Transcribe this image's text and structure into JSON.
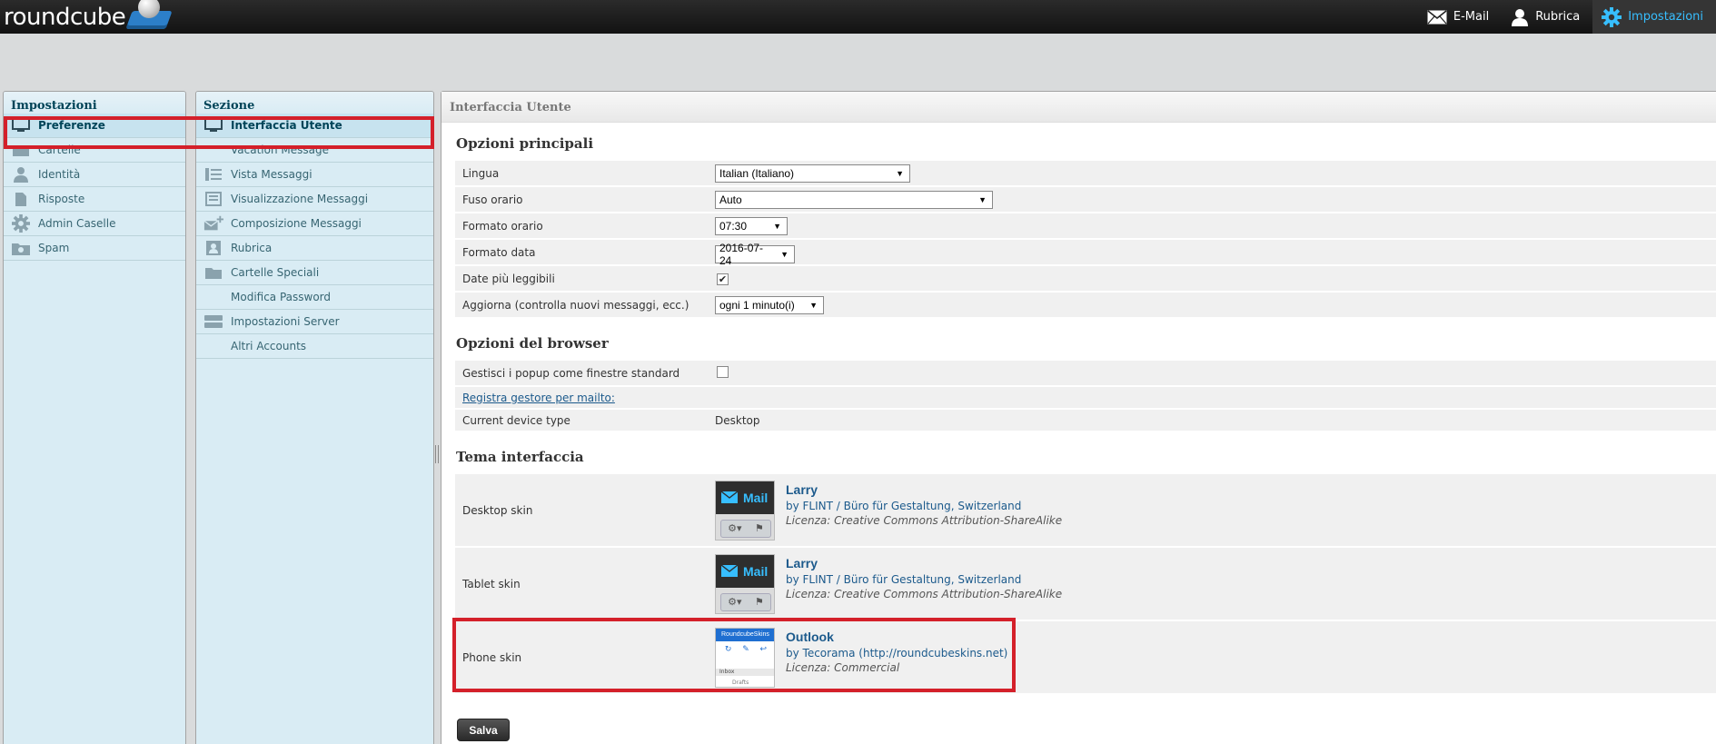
{
  "app": {
    "logo_text": "roundcube"
  },
  "topnav": [
    {
      "label": "E-Mail",
      "icon": "envelope-icon",
      "active": false
    },
    {
      "label": "Rubrica",
      "icon": "person-icon",
      "active": false
    },
    {
      "label": "Impostazioni",
      "icon": "gear-icon",
      "active": true
    }
  ],
  "settings_panel": {
    "title": "Impostazioni",
    "items": [
      {
        "label": "Preferenze",
        "icon": "monitor-icon",
        "selected": true
      },
      {
        "label": "Cartelle",
        "icon": "folder-icon"
      },
      {
        "label": "Identità",
        "icon": "person-icon"
      },
      {
        "label": "Risposte",
        "icon": "document-icon"
      },
      {
        "label": "Admin Caselle",
        "icon": "gear-icon"
      },
      {
        "label": "Spam",
        "icon": "spam-folder-icon"
      }
    ]
  },
  "section_panel": {
    "title": "Sezione",
    "items": [
      {
        "label": "Interfaccia Utente",
        "icon": "monitor-icon",
        "selected": true
      },
      {
        "label": "Vacation Message",
        "icon": ""
      },
      {
        "label": "Vista Messaggi",
        "icon": "list-view-icon"
      },
      {
        "label": "Visualizzazione Messaggi",
        "icon": "message-view-icon"
      },
      {
        "label": "Composizione Messaggi",
        "icon": "compose-icon"
      },
      {
        "label": "Rubrica",
        "icon": "addressbook-icon"
      },
      {
        "label": "Cartelle Speciali",
        "icon": "folder-icon"
      },
      {
        "label": "Modifica Password",
        "icon": ""
      },
      {
        "label": "Impostazioni Server",
        "icon": "server-icon"
      },
      {
        "label": "Altri Accounts",
        "icon": ""
      }
    ]
  },
  "main": {
    "header": "Interfaccia Utente",
    "sections": {
      "principali": {
        "title": "Opzioni principali",
        "lingua": {
          "label": "Lingua",
          "value": "Italian (Italiano)"
        },
        "fuso": {
          "label": "Fuso orario",
          "value": "Auto"
        },
        "formato_orario": {
          "label": "Formato orario",
          "value": "07:30"
        },
        "formato_data": {
          "label": "Formato data",
          "value": "2016-07-24"
        },
        "date_leggibili": {
          "label": "Date più leggibili",
          "checked": true
        },
        "aggiorna": {
          "label": "Aggiorna (controlla nuovi messaggi, ecc.)",
          "value": "ogni 1 minuto(i)"
        }
      },
      "browser": {
        "title": "Opzioni del browser",
        "popup": {
          "label": "Gestisci i popup come finestre standard",
          "checked": false
        },
        "mailto": {
          "label": "Registra gestore per mailto:"
        },
        "device": {
          "label": "Current device type",
          "value": "Desktop"
        }
      },
      "tema": {
        "title": "Tema interfaccia",
        "desktop": {
          "label": "Desktop skin",
          "name": "Larry",
          "by": "by FLINT / Büro für Gestaltung, Switzerland",
          "license": "Licenza: Creative Commons Attribution-ShareAlike",
          "thumb_text": "Mail"
        },
        "tablet": {
          "label": "Tablet skin",
          "name": "Larry",
          "by": "by FLINT / Büro für Gestaltung, Switzerland",
          "license": "Licenza: Creative Commons Attribution-ShareAlike",
          "thumb_text": "Mail"
        },
        "phone": {
          "label": "Phone skin",
          "name": "Outlook",
          "by": "by Tecorama (http://roundcubeskins.net)",
          "license": "Licenza: Commercial",
          "thumb_title": "RoundcubeSkins",
          "thumb_inbox": "Inbox",
          "thumb_drafts": "Drafts"
        }
      }
    },
    "save_label": "Salva"
  },
  "colors": {
    "accent": "#37beff",
    "highlight": "#d4202a",
    "link": "#1c5a8c"
  }
}
